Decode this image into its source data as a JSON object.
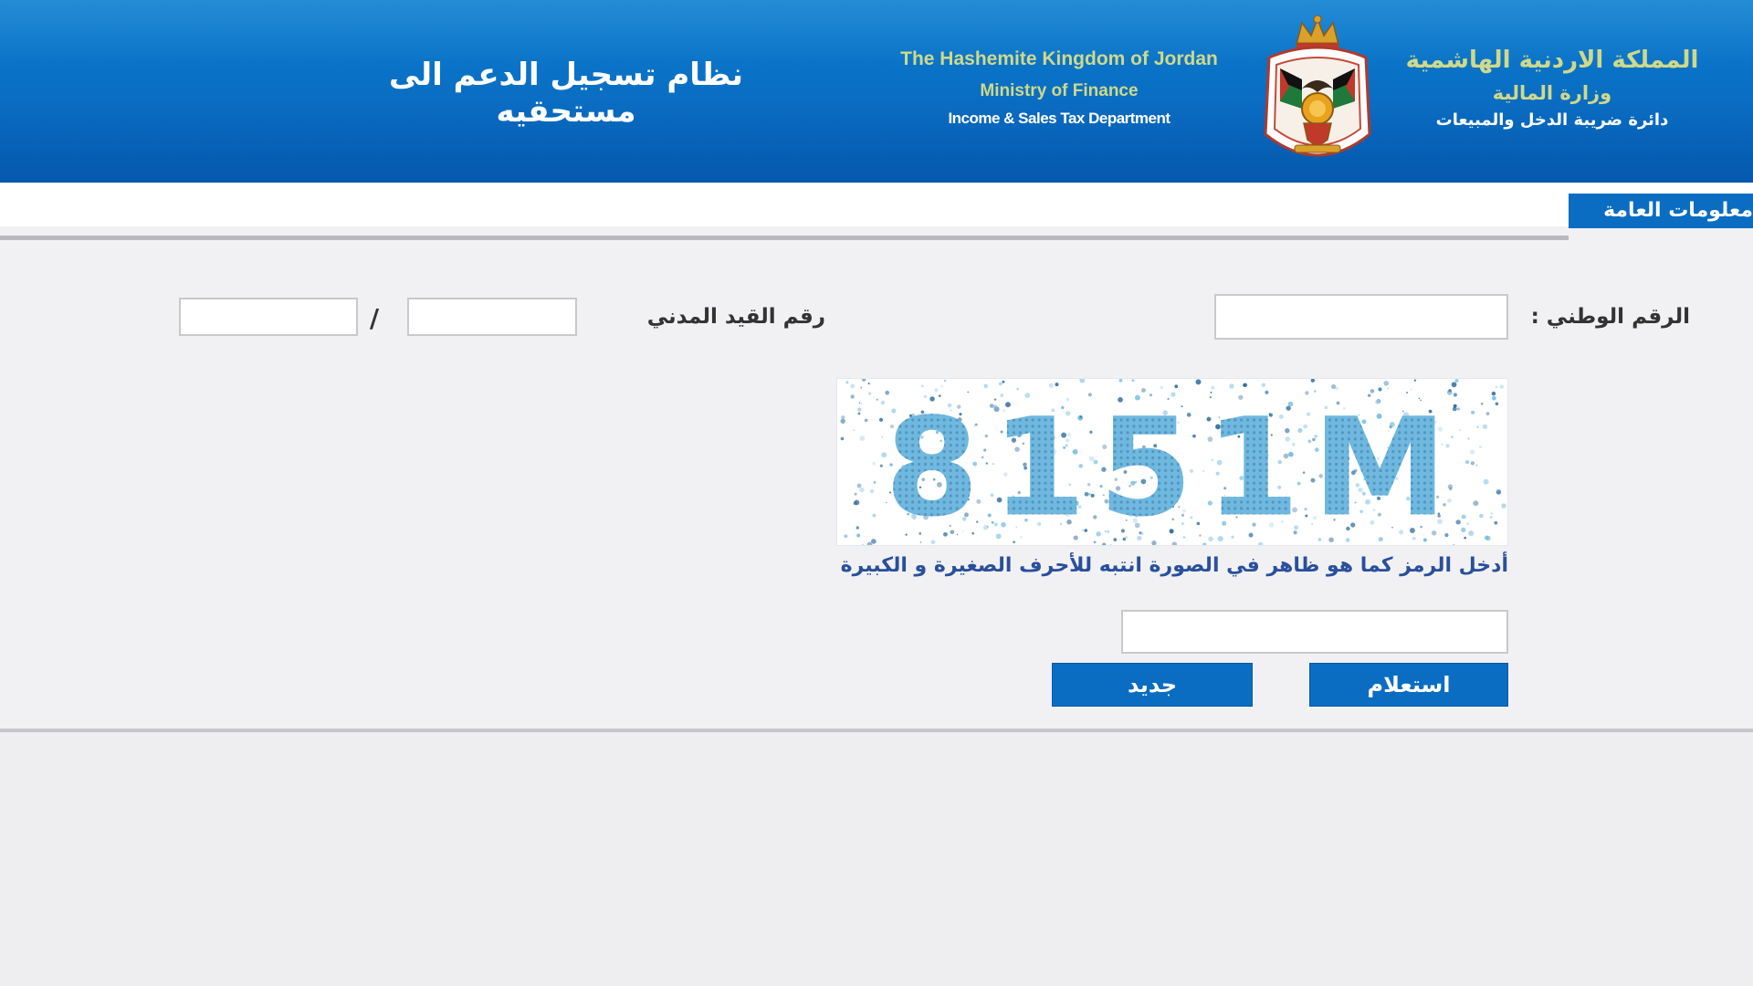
{
  "header": {
    "system_title": "نظام تسجيل الدعم الى مستحقيه",
    "english": {
      "line1": "The Hashemite Kingdom of Jordan",
      "line2": "Ministry of Finance",
      "line3": "Income & Sales Tax Department"
    },
    "arabic": {
      "line1": "المملكة الاردنية الهاشمية",
      "line2": "وزارة المالية",
      "line3": "دائرة ضريبة الدخل والمبيعات"
    },
    "emblem_icon": "jordan-coat-of-arms-icon"
  },
  "tabs": {
    "general_info": "معلومات العامة"
  },
  "form": {
    "national_id_label": "الرقم الوطني :",
    "national_id_value": "",
    "civil_registry_label": "رقم القيد المدني",
    "civil_registry_part1": "",
    "civil_registry_part2": "",
    "separator": "/",
    "captcha_text": "8151M",
    "captcha_note": "أدخل الرمز كما هو ظاهر في الصورة انتبه للأحرف الصغيرة و الكبيرة",
    "captcha_value": ""
  },
  "buttons": {
    "inquiry": "استعلام",
    "new": "جديد"
  },
  "colors": {
    "brand_blue": "#0a6dc2",
    "header_gold": "#cfd98a",
    "captcha_digits": "#6fb8df",
    "note_text": "#2a4f9b"
  }
}
